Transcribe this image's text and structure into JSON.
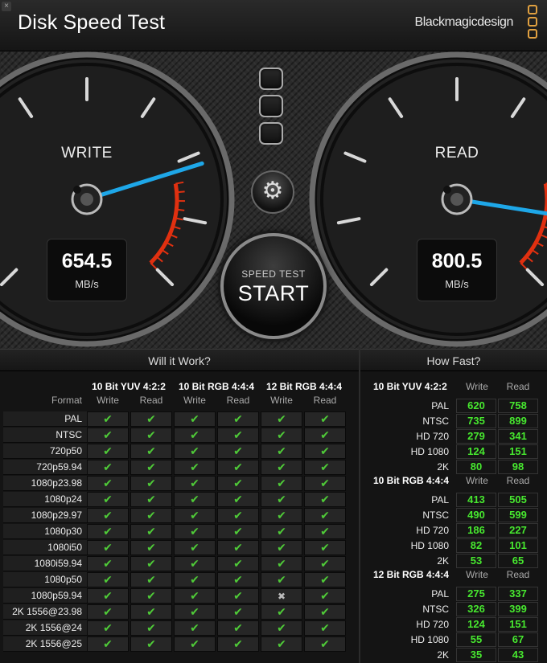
{
  "window": {
    "close_symbol": "×",
    "title": "Disk Speed Test",
    "brand": "Blackmagicdesign"
  },
  "gauges": {
    "write": {
      "label": "WRITE",
      "value": "654.5",
      "unit": "MB/s",
      "needle_fraction": 0.654
    },
    "read": {
      "label": "READ",
      "value": "800.5",
      "unit": "MB/s",
      "needle_fraction": 0.8
    }
  },
  "controls": {
    "settings_icon": "gear-icon",
    "start_small": "SPEED TEST",
    "start_big": "START"
  },
  "will_it_work": {
    "title": "Will it Work?",
    "format_label": "Format",
    "groups": [
      "10 Bit YUV 4:2:2",
      "10 Bit RGB 4:4:4",
      "12 Bit RGB 4:4:4"
    ],
    "col_labels": [
      "Write",
      "Read",
      "Write",
      "Read",
      "Write",
      "Read"
    ],
    "rows": [
      {
        "format": "PAL",
        "results": [
          "✔",
          "✔",
          "✔",
          "✔",
          "✔",
          "✔"
        ]
      },
      {
        "format": "NTSC",
        "results": [
          "✔",
          "✔",
          "✔",
          "✔",
          "✔",
          "✔"
        ]
      },
      {
        "format": "720p50",
        "results": [
          "✔",
          "✔",
          "✔",
          "✔",
          "✔",
          "✔"
        ]
      },
      {
        "format": "720p59.94",
        "results": [
          "✔",
          "✔",
          "✔",
          "✔",
          "✔",
          "✔"
        ]
      },
      {
        "format": "1080p23.98",
        "results": [
          "✔",
          "✔",
          "✔",
          "✔",
          "✔",
          "✔"
        ]
      },
      {
        "format": "1080p24",
        "results": [
          "✔",
          "✔",
          "✔",
          "✔",
          "✔",
          "✔"
        ]
      },
      {
        "format": "1080p29.97",
        "results": [
          "✔",
          "✔",
          "✔",
          "✔",
          "✔",
          "✔"
        ]
      },
      {
        "format": "1080p30",
        "results": [
          "✔",
          "✔",
          "✔",
          "✔",
          "✔",
          "✔"
        ]
      },
      {
        "format": "1080i50",
        "results": [
          "✔",
          "✔",
          "✔",
          "✔",
          "✔",
          "✔"
        ]
      },
      {
        "format": "1080i59.94",
        "results": [
          "✔",
          "✔",
          "✔",
          "✔",
          "✔",
          "✔"
        ]
      },
      {
        "format": "1080p50",
        "results": [
          "✔",
          "✔",
          "✔",
          "✔",
          "✔",
          "✔"
        ]
      },
      {
        "format": "1080p59.94",
        "results": [
          "✔",
          "✔",
          "✔",
          "✔",
          "✖",
          "✔"
        ]
      },
      {
        "format": "2K 1556@23.98",
        "results": [
          "✔",
          "✔",
          "✔",
          "✔",
          "✔",
          "✔"
        ]
      },
      {
        "format": "2K 1556@24",
        "results": [
          "✔",
          "✔",
          "✔",
          "✔",
          "✔",
          "✔"
        ]
      },
      {
        "format": "2K 1556@25",
        "results": [
          "✔",
          "✔",
          "✔",
          "✔",
          "✔",
          "✔"
        ]
      }
    ]
  },
  "how_fast": {
    "title": "How Fast?",
    "sections": [
      {
        "group": "10 Bit YUV 4:2:2",
        "write_label": "Write",
        "read_label": "Read",
        "rows": [
          {
            "name": "PAL",
            "write": "620",
            "read": "758"
          },
          {
            "name": "NTSC",
            "write": "735",
            "read": "899"
          },
          {
            "name": "HD 720",
            "write": "279",
            "read": "341"
          },
          {
            "name": "HD 1080",
            "write": "124",
            "read": "151"
          },
          {
            "name": "2K",
            "write": "80",
            "read": "98"
          }
        ]
      },
      {
        "group": "10 Bit RGB 4:4:4",
        "write_label": "Write",
        "read_label": "Read",
        "rows": [
          {
            "name": "PAL",
            "write": "413",
            "read": "505"
          },
          {
            "name": "NTSC",
            "write": "490",
            "read": "599"
          },
          {
            "name": "HD 720",
            "write": "186",
            "read": "227"
          },
          {
            "name": "HD 1080",
            "write": "82",
            "read": "101"
          },
          {
            "name": "2K",
            "write": "53",
            "read": "65"
          }
        ]
      },
      {
        "group": "12 Bit RGB 4:4:4",
        "write_label": "Write",
        "read_label": "Read",
        "rows": [
          {
            "name": "PAL",
            "write": "275",
            "read": "337"
          },
          {
            "name": "NTSC",
            "write": "326",
            "read": "399"
          },
          {
            "name": "HD 720",
            "write": "124",
            "read": "151"
          },
          {
            "name": "HD 1080",
            "write": "55",
            "read": "67"
          },
          {
            "name": "2K",
            "write": "35",
            "read": "43"
          }
        ]
      }
    ]
  },
  "colors": {
    "check": "#4fcb38",
    "speed_value": "#47e82f",
    "needle": "#1ea7e8",
    "redline": "#e03010",
    "brand_logo": "#e0a040"
  }
}
